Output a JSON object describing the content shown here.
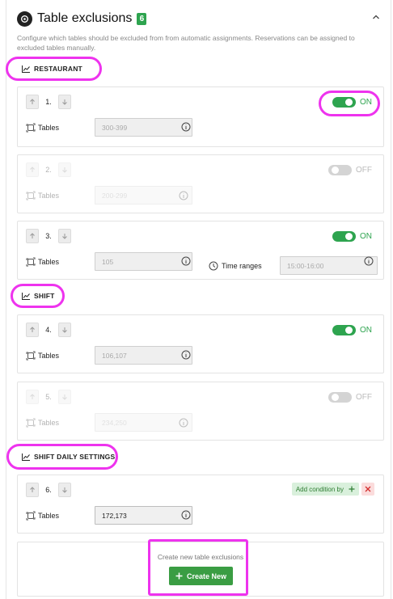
{
  "header": {
    "title": "Table exclusions",
    "count": "6"
  },
  "description": "Configure which tables should be excluded from from automatic assignments. Reservations can be assigned to excluded tables manually.",
  "sections": [
    {
      "label": "RESTAURANT"
    },
    {
      "label": "SHIFT"
    },
    {
      "label": "SHIFT DAILY SETTINGS"
    }
  ],
  "rules": [
    {
      "order": "1.",
      "toggle": "ON",
      "enabled": true,
      "tables_label": "Tables",
      "tables_placeholder": "300-399"
    },
    {
      "order": "2.",
      "toggle": "OFF",
      "enabled": false,
      "tables_label": "Tables",
      "tables_placeholder": "200-299"
    },
    {
      "order": "3.",
      "toggle": "ON",
      "enabled": true,
      "tables_label": "Tables",
      "tables_placeholder": "105",
      "time_label": "Time ranges",
      "time_placeholder": "15:00-16:00"
    },
    {
      "order": "4.",
      "toggle": "ON",
      "enabled": true,
      "tables_label": "Tables",
      "tables_placeholder": "106,107"
    },
    {
      "order": "5.",
      "toggle": "OFF",
      "enabled": false,
      "tables_label": "Tables",
      "tables_placeholder": "234,250"
    },
    {
      "order": "6.",
      "add_condition": "Add condition by",
      "tables_label": "Tables",
      "tables_value": "172,173"
    }
  ],
  "create": {
    "text": "Create new table exclusions",
    "button_label": "Create New"
  },
  "colors": {
    "accent_green": "#2ea44f",
    "highlight": "#ee33ee",
    "delete_red": "#d32f2f"
  }
}
